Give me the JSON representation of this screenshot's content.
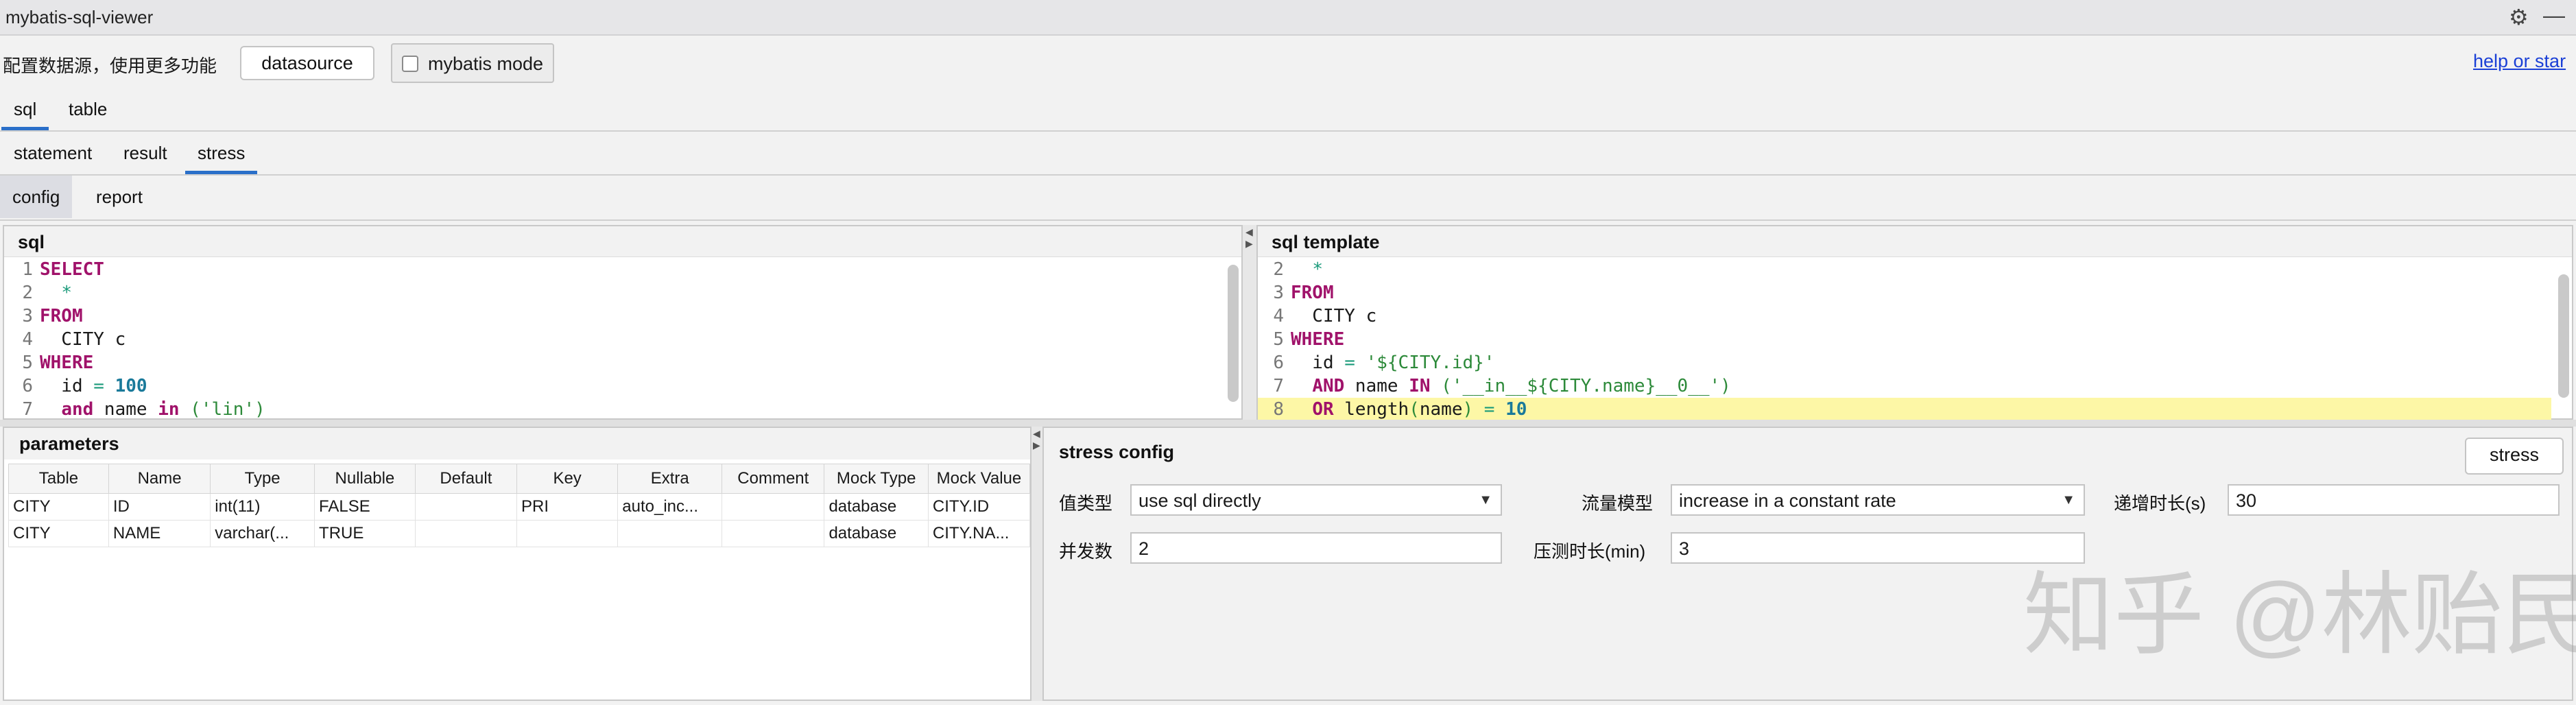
{
  "window": {
    "title": "mybatis-sql-viewer"
  },
  "toolbar": {
    "hint": "配置数据源，使用更多功能",
    "datasource_label": "datasource",
    "mybatis_mode_label": "mybatis mode",
    "help_label": "help or star"
  },
  "tabs_main": [
    "sql",
    "table"
  ],
  "tabs_sub": [
    "statement",
    "result",
    "stress"
  ],
  "tabs_stress": [
    "config",
    "report"
  ],
  "sql_panel": {
    "title": "sql",
    "lines": [
      {
        "n": "1",
        "parts": [
          {
            "t": "SELECT",
            "c": "kw"
          }
        ]
      },
      {
        "n": "2",
        "parts": [
          {
            "t": "  "
          },
          {
            "t": "*",
            "c": "star"
          }
        ]
      },
      {
        "n": "3",
        "parts": [
          {
            "t": "FROM",
            "c": "kw"
          }
        ]
      },
      {
        "n": "4",
        "parts": [
          {
            "t": "  CITY c"
          }
        ]
      },
      {
        "n": "5",
        "parts": [
          {
            "t": "WHERE",
            "c": "kw"
          }
        ]
      },
      {
        "n": "6",
        "parts": [
          {
            "t": "  id "
          },
          {
            "t": "=",
            "c": "op"
          },
          {
            "t": " "
          },
          {
            "t": "100",
            "c": "num"
          }
        ]
      },
      {
        "n": "7",
        "parts": [
          {
            "t": "  "
          },
          {
            "t": "and",
            "c": "kw"
          },
          {
            "t": " name "
          },
          {
            "t": "in",
            "c": "kw"
          },
          {
            "t": " "
          },
          {
            "t": "('lin')",
            "c": "str"
          }
        ]
      }
    ]
  },
  "template_panel": {
    "title": "sql template",
    "lines": [
      {
        "n": "2",
        "parts": [
          {
            "t": "  "
          },
          {
            "t": "*",
            "c": "star"
          }
        ]
      },
      {
        "n": "3",
        "parts": [
          {
            "t": "FROM",
            "c": "kw"
          }
        ]
      },
      {
        "n": "4",
        "parts": [
          {
            "t": "  CITY c"
          }
        ]
      },
      {
        "n": "5",
        "parts": [
          {
            "t": "WHERE",
            "c": "kw"
          }
        ]
      },
      {
        "n": "6",
        "parts": [
          {
            "t": "  id "
          },
          {
            "t": "=",
            "c": "op"
          },
          {
            "t": " "
          },
          {
            "t": "'${CITY.id}'",
            "c": "str"
          }
        ]
      },
      {
        "n": "7",
        "parts": [
          {
            "t": "  "
          },
          {
            "t": "AND",
            "c": "kw"
          },
          {
            "t": " name "
          },
          {
            "t": "IN",
            "c": "kw"
          },
          {
            "t": " "
          },
          {
            "t": "('__in__${CITY.name}__0__')",
            "c": "str"
          }
        ]
      },
      {
        "n": "8",
        "hl": true,
        "parts": [
          {
            "t": "  "
          },
          {
            "t": "OR",
            "c": "kw"
          },
          {
            "t": " length"
          },
          {
            "t": "(",
            "c": "str"
          },
          {
            "t": "name"
          },
          {
            "t": ")",
            "c": "str"
          },
          {
            "t": " "
          },
          {
            "t": "=",
            "c": "op"
          },
          {
            "t": " "
          },
          {
            "t": "10",
            "c": "num"
          }
        ]
      }
    ]
  },
  "parameters": {
    "title": "parameters",
    "columns": [
      "Table",
      "Name",
      "Type",
      "Nullable",
      "Default",
      "Key",
      "Extra",
      "Comment",
      "Mock Type",
      "Mock Value"
    ],
    "rows": [
      [
        "CITY",
        "ID",
        "int(11)",
        "FALSE",
        "",
        "PRI",
        "auto_inc...",
        "",
        "database",
        "CITY.ID"
      ],
      [
        "CITY",
        "NAME",
        "varchar(...",
        "TRUE",
        "",
        "",
        "",
        "",
        "database",
        "CITY.NA..."
      ]
    ]
  },
  "stress": {
    "title": "stress config",
    "button": "stress",
    "value_type_label": "值类型",
    "value_type": "use sql directly",
    "traffic_label": "流量模型",
    "traffic_value": "increase in a constant rate",
    "ramp_label": "递增时长(s)",
    "ramp_value": "30",
    "concurrency_label": "并发数",
    "concurrency_value": "2",
    "duration_label": "压测时长(min)",
    "duration_value": "3"
  },
  "watermark": "知乎 @林贻民"
}
